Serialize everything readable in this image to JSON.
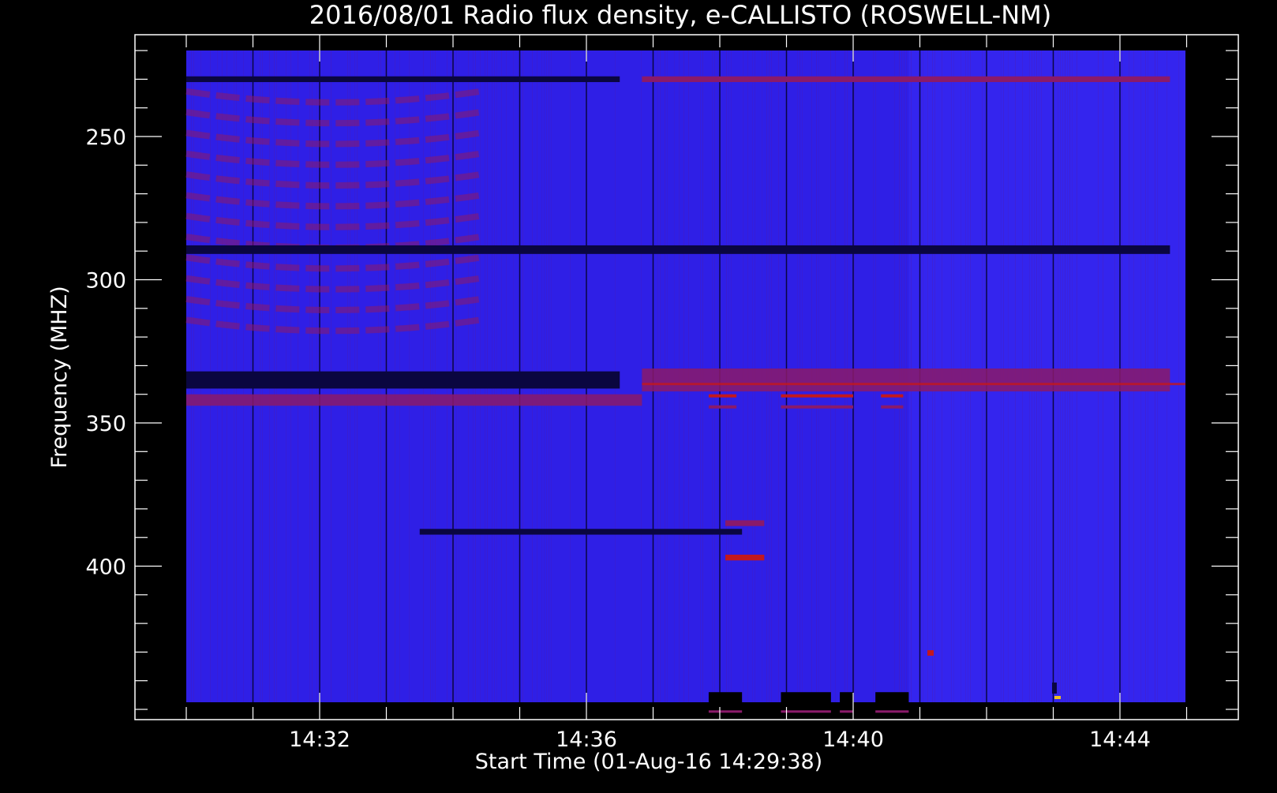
{
  "chart_data": {
    "type": "heatmap",
    "title": "2016/08/01  Radio flux density, e-CALLISTO (ROSWELL-NM)",
    "xlabel": "Start Time (01-Aug-16 14:29:38)",
    "ylabel": "Frequency (MHZ)",
    "x_start": "14:29:38",
    "x_end": "14:44:45",
    "y_range": [
      214,
      452
    ],
    "y_reversed": true,
    "y_ticks": [
      250,
      300,
      350,
      400
    ],
    "y_tick_labels": [
      "250",
      "300",
      "350",
      "400"
    ],
    "x_ticks": [
      "14:32",
      "14:36",
      "14:40",
      "14:44"
    ],
    "colors": {
      "background": "#000000",
      "field": "#2f1fe6",
      "field_light": "#3a2cf5",
      "dark_band": "#0a0640",
      "red_band": "#8a1a6a",
      "bright_red": "#c2181e",
      "yellow_spot": "#f0c020"
    },
    "features": [
      {
        "kind": "dark_line",
        "start": "14:29:38",
        "end": "14:36:30",
        "freq_lo": 229,
        "freq_hi": 231
      },
      {
        "kind": "red_line",
        "start": "14:36:50",
        "end": "14:44:45",
        "freq_lo": 229,
        "freq_hi": 231
      },
      {
        "kind": "interference_arcs",
        "start": "14:29:38",
        "end": "14:34:25",
        "freq_lo": 237,
        "freq_hi": 324
      },
      {
        "kind": "dark_line",
        "start": "14:29:38",
        "end": "14:44:45",
        "freq_lo": 288,
        "freq_hi": 291
      },
      {
        "kind": "dark_band",
        "start": "14:29:38",
        "end": "14:36:30",
        "freq_lo": 332,
        "freq_hi": 338
      },
      {
        "kind": "red_band",
        "start": "14:36:50",
        "end": "14:44:45",
        "freq_lo": 331,
        "freq_hi": 339
      },
      {
        "kind": "red_band",
        "start": "14:29:38",
        "end": "14:36:50",
        "freq_lo": 340,
        "freq_hi": 344
      },
      {
        "kind": "red_dashes",
        "start": "14:37:50",
        "end": "14:40:45",
        "freq_lo": 340,
        "freq_hi": 348
      },
      {
        "kind": "red_line",
        "start": "14:38:05",
        "end": "14:38:40",
        "freq_lo": 384,
        "freq_hi": 386
      },
      {
        "kind": "bright_red_line",
        "start": "14:38:05",
        "end": "14:38:40",
        "freq_lo": 396,
        "freq_hi": 398
      },
      {
        "kind": "dark_line",
        "start": "14:33:30",
        "end": "14:38:20",
        "freq_lo": 387,
        "freq_hi": 389
      },
      {
        "kind": "dark_blocks",
        "start": "14:37:50",
        "end": "14:40:45",
        "freq_lo": 444,
        "freq_hi": 452
      }
    ]
  }
}
